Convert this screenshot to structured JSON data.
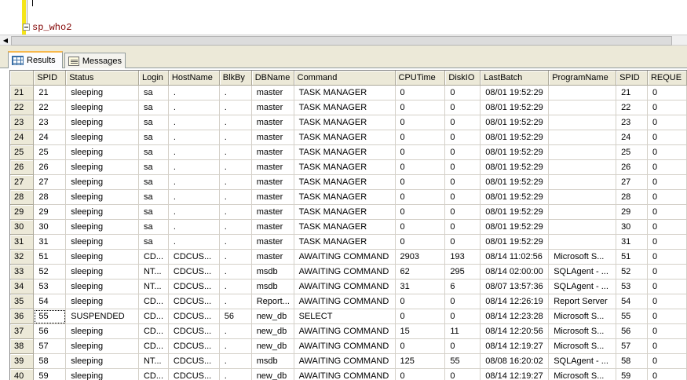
{
  "editor": {
    "query": "sp_who2"
  },
  "tabs": [
    {
      "label": "Results",
      "icon": "grid-icon",
      "active": true
    },
    {
      "label": "Messages",
      "icon": "messages-icon",
      "active": false
    }
  ],
  "grid": {
    "columns": [
      "SPID",
      "Status",
      "Login",
      "HostName",
      "BlkBy",
      "DBName",
      "Command",
      "CPUTime",
      "DiskIO",
      "LastBatch",
      "ProgramName",
      "SPID",
      "REQUE"
    ],
    "rows": [
      {
        "n": "21",
        "cells": [
          "21",
          "sleeping",
          "sa",
          ".",
          ".",
          "master",
          "TASK MANAGER",
          "0",
          "0",
          "08/01 19:52:29",
          "",
          "21",
          "0"
        ]
      },
      {
        "n": "22",
        "cells": [
          "22",
          "sleeping",
          "sa",
          ".",
          ".",
          "master",
          "TASK MANAGER",
          "0",
          "0",
          "08/01 19:52:29",
          "",
          "22",
          "0"
        ]
      },
      {
        "n": "23",
        "cells": [
          "23",
          "sleeping",
          "sa",
          ".",
          ".",
          "master",
          "TASK MANAGER",
          "0",
          "0",
          "08/01 19:52:29",
          "",
          "23",
          "0"
        ]
      },
      {
        "n": "24",
        "cells": [
          "24",
          "sleeping",
          "sa",
          ".",
          ".",
          "master",
          "TASK MANAGER",
          "0",
          "0",
          "08/01 19:52:29",
          "",
          "24",
          "0"
        ]
      },
      {
        "n": "25",
        "cells": [
          "25",
          "sleeping",
          "sa",
          ".",
          ".",
          "master",
          "TASK MANAGER",
          "0",
          "0",
          "08/01 19:52:29",
          "",
          "25",
          "0"
        ]
      },
      {
        "n": "26",
        "cells": [
          "26",
          "sleeping",
          "sa",
          ".",
          ".",
          "master",
          "TASK MANAGER",
          "0",
          "0",
          "08/01 19:52:29",
          "",
          "26",
          "0"
        ]
      },
      {
        "n": "27",
        "cells": [
          "27",
          "sleeping",
          "sa",
          ".",
          ".",
          "master",
          "TASK MANAGER",
          "0",
          "0",
          "08/01 19:52:29",
          "",
          "27",
          "0"
        ]
      },
      {
        "n": "28",
        "cells": [
          "28",
          "sleeping",
          "sa",
          ".",
          ".",
          "master",
          "TASK MANAGER",
          "0",
          "0",
          "08/01 19:52:29",
          "",
          "28",
          "0"
        ]
      },
      {
        "n": "29",
        "cells": [
          "29",
          "sleeping",
          "sa",
          ".",
          ".",
          "master",
          "TASK MANAGER",
          "0",
          "0",
          "08/01 19:52:29",
          "",
          "29",
          "0"
        ]
      },
      {
        "n": "30",
        "cells": [
          "30",
          "sleeping",
          "sa",
          ".",
          ".",
          "master",
          "TASK MANAGER",
          "0",
          "0",
          "08/01 19:52:29",
          "",
          "30",
          "0"
        ]
      },
      {
        "n": "31",
        "cells": [
          "31",
          "sleeping",
          "sa",
          ".",
          ".",
          "master",
          "TASK MANAGER",
          "0",
          "0",
          "08/01 19:52:29",
          "",
          "31",
          "0"
        ]
      },
      {
        "n": "32",
        "cells": [
          "51",
          "sleeping",
          "CD...",
          "CDCUS...",
          ".",
          "master",
          "AWAITING COMMAND",
          "2903",
          "193",
          "08/14 11:02:56",
          "Microsoft S...",
          "51",
          "0"
        ]
      },
      {
        "n": "33",
        "cells": [
          "52",
          "sleeping",
          "NT...",
          "CDCUS...",
          ".",
          "msdb",
          "AWAITING COMMAND",
          "62",
          "295",
          "08/14 02:00:00",
          "SQLAgent - ...",
          "52",
          "0"
        ]
      },
      {
        "n": "34",
        "cells": [
          "53",
          "sleeping",
          "NT...",
          "CDCUS...",
          ".",
          "msdb",
          "AWAITING COMMAND",
          "31",
          "6",
          "08/07 13:57:36",
          "SQLAgent - ...",
          "53",
          "0"
        ]
      },
      {
        "n": "35",
        "cells": [
          "54",
          "sleeping",
          "CD...",
          "CDCUS...",
          ".",
          "Report...",
          "AWAITING COMMAND",
          "0",
          "0",
          "08/14 12:26:19",
          "Report Server",
          "54",
          "0"
        ]
      },
      {
        "n": "36",
        "cells": [
          "55",
          "SUSPENDED",
          "CD...",
          "CDCUS...",
          "56",
          "new_db",
          "SELECT",
          "0",
          "0",
          "08/14 12:23:28",
          "Microsoft S...",
          "55",
          "0"
        ],
        "selected": true
      },
      {
        "n": "37",
        "cells": [
          "56",
          "sleeping",
          "CD...",
          "CDCUS...",
          ".",
          "new_db",
          "AWAITING COMMAND",
          "15",
          "11",
          "08/14 12:20:56",
          "Microsoft S...",
          "56",
          "0"
        ]
      },
      {
        "n": "38",
        "cells": [
          "57",
          "sleeping",
          "CD...",
          "CDCUS...",
          ".",
          "new_db",
          "AWAITING COMMAND",
          "0",
          "0",
          "08/14 12:19:27",
          "Microsoft S...",
          "57",
          "0"
        ]
      },
      {
        "n": "39",
        "cells": [
          "58",
          "sleeping",
          "NT...",
          "CDCUS...",
          ".",
          "msdb",
          "AWAITING COMMAND",
          "125",
          "55",
          "08/08 16:20:02",
          "SQLAgent - ...",
          "58",
          "0"
        ]
      },
      {
        "n": "40",
        "cells": [
          "59",
          "sleeping",
          "CD...",
          "CDCUS...",
          ".",
          "new_db",
          "AWAITING COMMAND",
          "0",
          "0",
          "08/14 12:19:27",
          "Microsoft S...",
          "59",
          "0"
        ]
      }
    ]
  }
}
